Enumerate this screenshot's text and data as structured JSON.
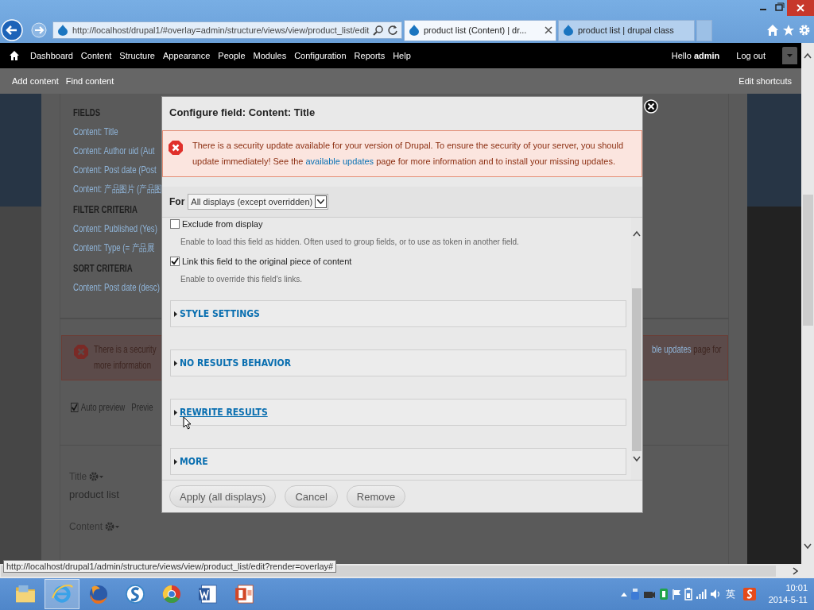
{
  "browser": {
    "address": "http://localhost/drupal1/#overlay=admin/structure/views/view/product_list/edit",
    "tabs": [
      {
        "label": "product list (Content) | dr...",
        "selected": true
      },
      {
        "label": "product list | drupal class",
        "selected": false
      }
    ]
  },
  "toolbar": {
    "menu": [
      "Dashboard",
      "Content",
      "Structure",
      "Appearance",
      "People",
      "Modules",
      "Configuration",
      "Reports",
      "Help"
    ],
    "greeting": "Hello **admin**",
    "logout": "Log out"
  },
  "shortcuts": {
    "items": [
      "Add content",
      "Find content"
    ],
    "edit": "Edit shortcuts"
  },
  "page": {
    "sections": [
      {
        "heading": "FIELDS",
        "links": [
          "Content: Title",
          "Content: Author uid (Aut",
          "Content: Post date (Post",
          "Content: 产品图片 (产品图"
        ]
      },
      {
        "heading": "FILTER CRITERIA",
        "links": [
          "Content: Published (Yes)",
          "Content: Type (= 产品展"
        ]
      },
      {
        "heading": "SORT CRITERIA",
        "links": [
          "Content: Post date (desc)"
        ]
      }
    ],
    "alert": {
      "line_1": "There is a security",
      "line_2": "more information",
      "link": "ble updates",
      "tail": "page for"
    },
    "auto_preview": {
      "label": "Auto preview",
      "checked": true
    },
    "preview": "Previe",
    "title_label": "Title",
    "title_value": "product list",
    "content_label": "Content"
  },
  "dialog": {
    "title": "Configure field: Content: Title",
    "message": {
      "before": "There is a security update available for your version of Drupal. To ensure the security of your server, you should update immediately! See the",
      "link": "available updates",
      "after": "page for more information and to install your missing updates."
    },
    "for_label": "For",
    "display": "All displays (except overridden)",
    "options": [
      {
        "label": "Exclude from display",
        "checked": false,
        "description": "Enable to load this field as hidden. Often used to group fields, or to use as token in another field."
      },
      {
        "label": "Link this field to the original piece of content",
        "checked": true,
        "description": "Enable to override this field's links."
      }
    ],
    "fieldsets": [
      {
        "title": "STYLE SETTINGS",
        "hovered": false
      },
      {
        "title": "NO RESULTS BEHAVIOR",
        "hovered": false
      },
      {
        "title": "REWRITE RESULTS",
        "hovered": true
      },
      {
        "title": "MORE",
        "hovered": false
      }
    ],
    "buttons": [
      "Apply (all displays)",
      "Cancel",
      "Remove"
    ]
  },
  "status_url": "http://localhost/drupal1/admin/structure/views/view/product_list/edit?render=overlay#",
  "taskbar": {
    "apps": [
      {
        "selected": false
      },
      {
        "selected": true
      },
      {
        "selected": false
      },
      {
        "selected": false
      },
      {
        "selected": false
      },
      {
        "selected": false
      },
      {
        "selected": false
      }
    ],
    "ime": "英",
    "time": "10:01",
    "date": "2014-5-11"
  }
}
